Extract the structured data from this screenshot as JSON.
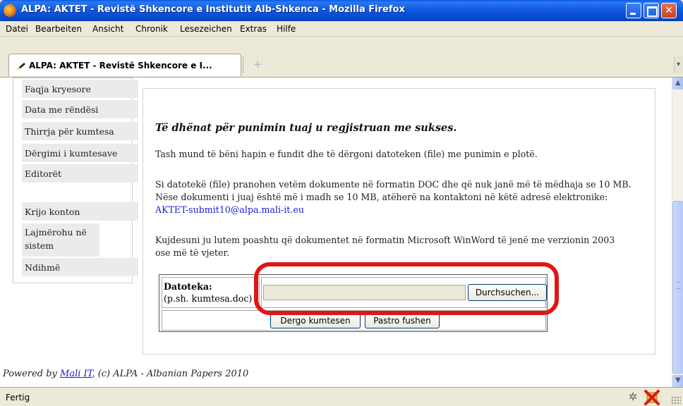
{
  "window": {
    "title": "ALPA: AKTET - Revistë Shkencore e Institutit Alb-Shkenca - Mozilla Firefox",
    "app_icon": "firefox-icon"
  },
  "menubar": {
    "items": [
      "Datei",
      "Bearbeiten",
      "Ansicht",
      "Chronik",
      "Lesezeichen",
      "Extras",
      "Hilfe"
    ]
  },
  "tabs": [
    {
      "label": "ALPA: AKTET - Revistë Shkencore e I...",
      "active": true
    }
  ],
  "newtab_label": "+",
  "sidebar": {
    "items": [
      "Faqja kryesore",
      "Data me rëndësi",
      "Thirrja për kumtesa",
      "Dërgimi i kumtesave",
      "Editorët",
      "Krijo konton",
      "Lajmërohu në sistem",
      "Ndihmë"
    ]
  },
  "main": {
    "heading": "Të dhënat për punimin tuaj u regjistruan me sukses.",
    "paragraph1": "Tash mund të bëni hapin e fundit dhe të dërgoni datoteken (file) me punimin e plotë.",
    "paragraph2_line1": "Si datotekë (file) pranohen vetëm dokumente në formatin DOC dhe që nuk janë më të mëdhaja se 10 MB.",
    "paragraph2_line2": "Nëse dokumenti i juaj është më i madh se 10 MB, atëherë na kontaktoni në këtë adresë elektronike:",
    "email": "AKTET-submit10@alpa.mali-it.eu",
    "paragraph3_line1": "Kujdesuni ju lutem poashtu që dokumentet në formatin Microsoft WinWord të jenë me verzionin 2003",
    "paragraph3_line2": "ose më të vjeter."
  },
  "form": {
    "file_label": "Datoteka:",
    "file_hint": "(p.sh. kumtesa.doc)",
    "file_value": "",
    "browse_label": "Durchsuchen...",
    "submit_label": "Dergo kumtesen",
    "reset_label": "Pastro fushen"
  },
  "footer": {
    "prefix": "Powered by ",
    "link": "Mali IT",
    "suffix": ", (c) ALPA - Albanian Papers 2010"
  },
  "status": {
    "text": "Fertig"
  },
  "colors": {
    "annotation": "#e01616",
    "link": "#1a1ad8",
    "titlebar": "#0d57e0"
  }
}
